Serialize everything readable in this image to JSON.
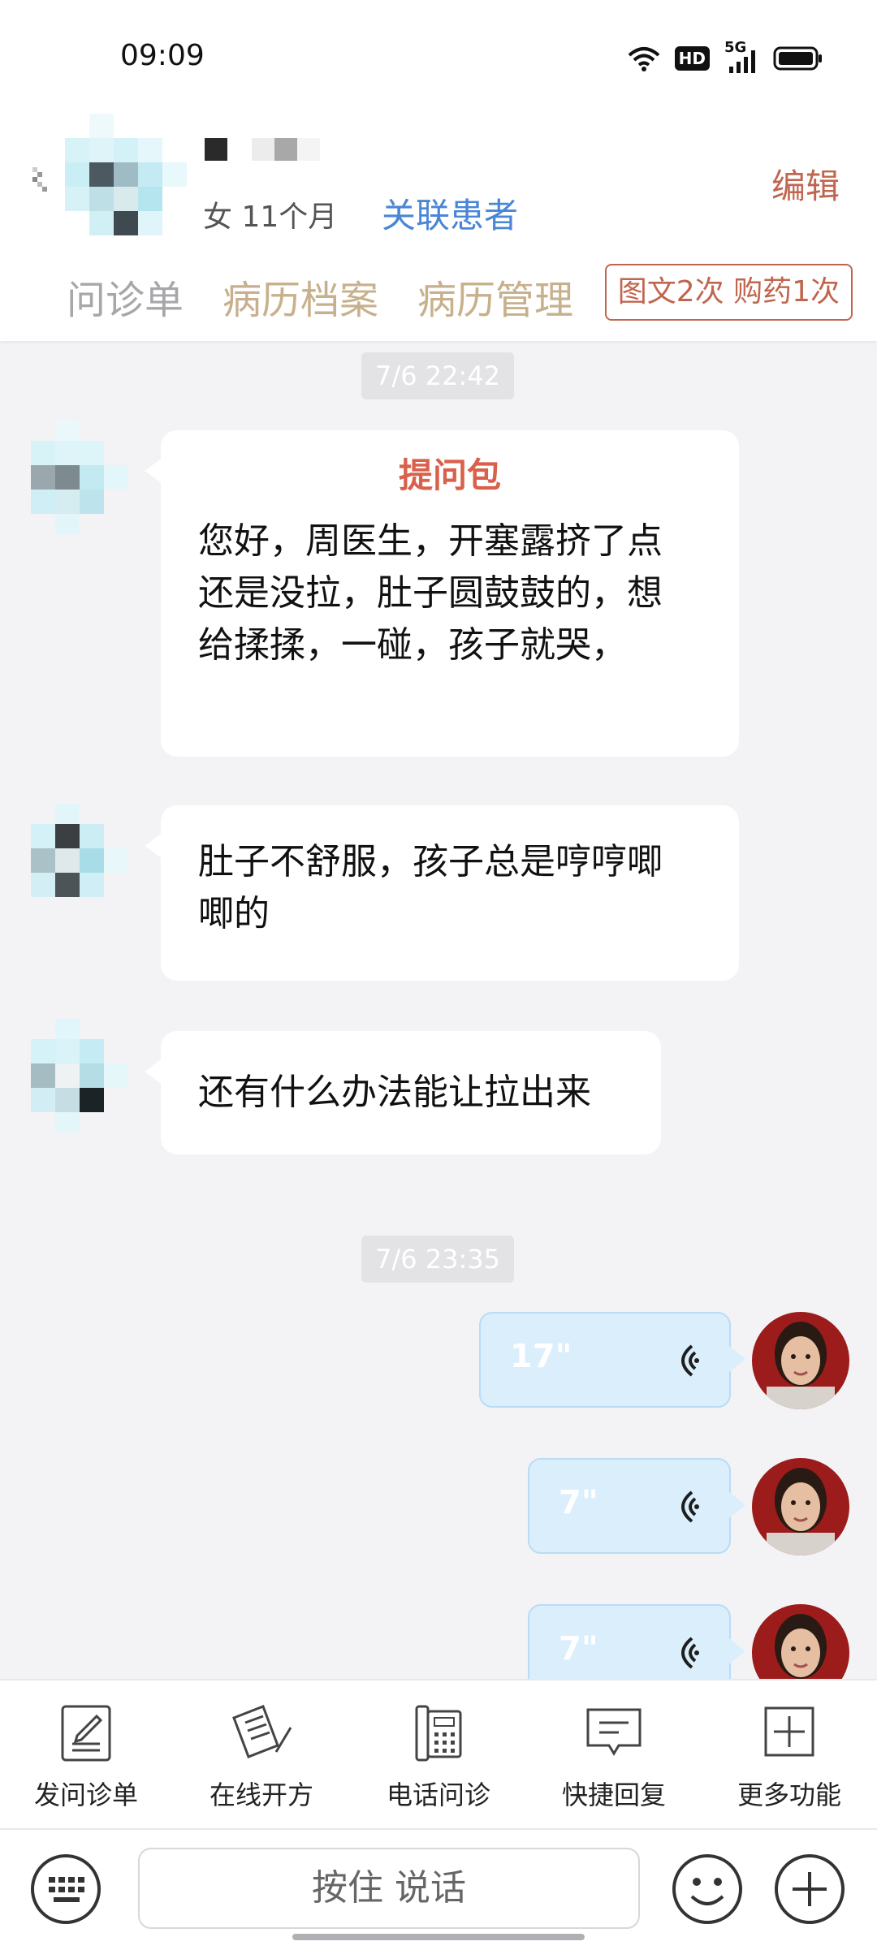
{
  "status": {
    "time": "09:09",
    "hd": "HD",
    "network": "5G"
  },
  "header": {
    "patient_meta": "女 11个月",
    "link_patient": "关联患者",
    "edit": "编辑",
    "tabs": [
      "问诊单",
      "病历档案",
      "病历管理"
    ],
    "service_tag": "图文2次 购药1次"
  },
  "chat": {
    "timestamps": [
      "7/6 22:42",
      "7/6 23:35"
    ],
    "question_package": {
      "title": "提问包",
      "lines": [
        "您好，周医生，开塞露挤了点",
        "还是没拉，肚子圆鼓鼓的，想",
        "给揉揉，一碰，孩子就哭，"
      ]
    },
    "msg2_lines": [
      "肚子不舒服，孩子总是哼哼唧",
      "唧的"
    ],
    "msg3": "还有什么办法能让拉出来",
    "voice_messages": [
      "17\"",
      "7\"",
      "7\""
    ]
  },
  "toolbar": {
    "items": [
      {
        "label": "发问诊单",
        "icon": "questionnaire-icon"
      },
      {
        "label": "在线开方",
        "icon": "prescription-icon"
      },
      {
        "label": "电话问诊",
        "icon": "phone-consult-icon"
      },
      {
        "label": "快捷回复",
        "icon": "quick-reply-icon"
      },
      {
        "label": "更多功能",
        "icon": "more-functions-icon"
      }
    ]
  },
  "input": {
    "press_to_talk": "按住 说话"
  },
  "colors": {
    "accent": "#c0664f",
    "link": "#4a86d6",
    "tab": "#c7b08c",
    "voice_bubble": "#dbeefc"
  }
}
